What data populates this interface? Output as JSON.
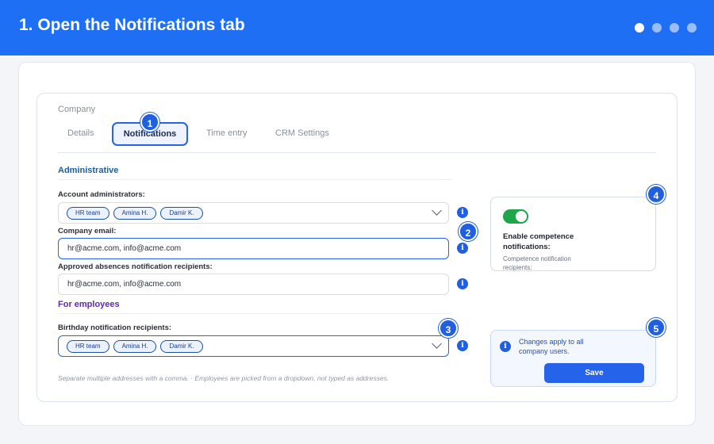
{
  "header": {
    "title": "1. Open the Notifications tab",
    "steps_total": 4,
    "steps_active": 1,
    "bg_color": "#1f6ff5"
  },
  "breadcrumb": "Company",
  "tabs": [
    {
      "label": "Details",
      "active": false
    },
    {
      "label": "Notifications",
      "active": true
    },
    {
      "label": "Time entry",
      "active": false
    },
    {
      "label": "CRM Settings",
      "active": false
    }
  ],
  "sections": {
    "administrative": "Administrative",
    "employees": "For employees"
  },
  "fields": {
    "account_admins": {
      "label": "Account administrators:",
      "chips": [
        "HR team",
        "Amina H.",
        "Damir K."
      ]
    },
    "company_email": {
      "label": "Company email:",
      "value": "hr@acme.com, info@acme.com"
    },
    "absences": {
      "label": "Approved absences notification recipients:",
      "value": "hr@acme.com, info@acme.com"
    },
    "birthday": {
      "label": "Birthday notification recipients:",
      "chips": [
        "HR team",
        "Amina H.",
        "Damir K."
      ]
    }
  },
  "competence_card": {
    "toggle_on": true,
    "title": "Enable competence notifications:",
    "subtitle": "Competence notification recipients:"
  },
  "note_card": {
    "text": "Changes apply to all company users.",
    "save_label": "Save"
  },
  "help_text": "Separate multiple addresses with a comma. · Employees are picked from a dropdown, not typed as addresses.",
  "step_badges": [
    "1",
    "2",
    "3",
    "4",
    "5"
  ],
  "info_icon_glyph": "i",
  "colors": {
    "accent": "#2563eb",
    "toggle_on": "#1fa54a",
    "admin_heading": "#1d5e9e",
    "employee_heading": "#5b2bb0"
  }
}
